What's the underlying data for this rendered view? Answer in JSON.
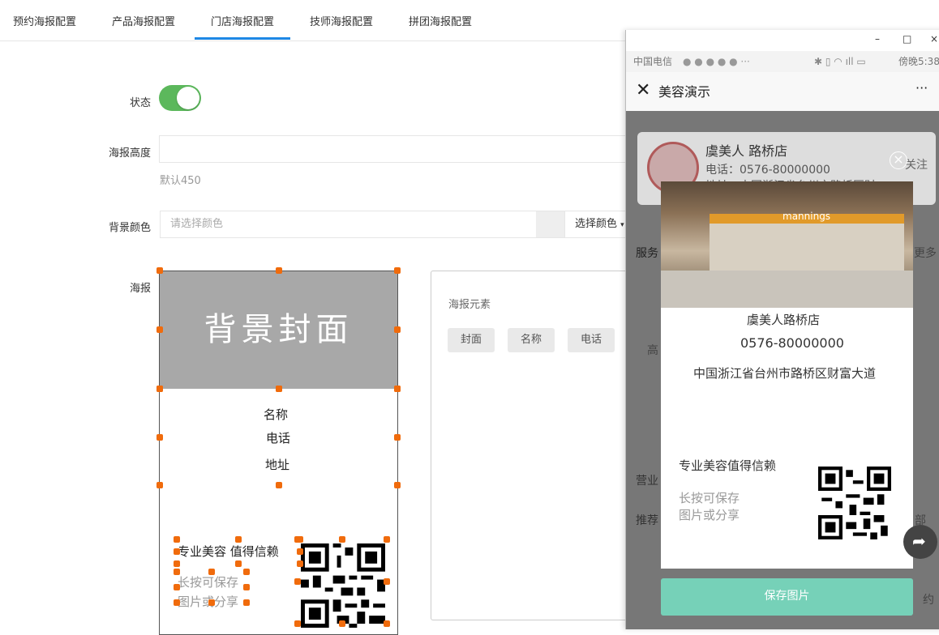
{
  "tabs": [
    {
      "label": "预约海报配置"
    },
    {
      "label": "产品海报配置"
    },
    {
      "label": "门店海报配置"
    },
    {
      "label": "技师海报配置"
    },
    {
      "label": "拼团海报配置"
    }
  ],
  "form": {
    "status_label": "状态",
    "height_label": "海报高度",
    "height_value": "",
    "height_hint": "默认450",
    "bg_color_label": "背景颜色",
    "bg_color_placeholder": "请选择颜色",
    "bg_color_button": "选择颜色",
    "poster_label": "海报"
  },
  "poster": {
    "cover_text": "背景封面",
    "name_text": "名称",
    "phone_text": "电话",
    "address_text": "地址",
    "slogan": "专业美容 值得信赖",
    "hint_line1": "长按可保存",
    "hint_line2": "图片或分享",
    "handle_color": "#f06b0c"
  },
  "elements_panel": {
    "title": "海报元素",
    "chips": [
      {
        "label": "封面"
      },
      {
        "label": "名称"
      },
      {
        "label": "电话"
      }
    ]
  },
  "phone": {
    "window_controls": {
      "minimize": "–",
      "maximize": "□",
      "close": "×"
    },
    "status_left": "中国电信",
    "status_right": "傍晚5:38",
    "title": "美容演示",
    "more": "···",
    "store_name": "虞美人 路桥店",
    "store_phone": "电话：0576-80000000",
    "store_address": "地址：中国浙江省台州市路桥区财",
    "follow": "关注",
    "bg_service": "服务",
    "bg_more": "更多",
    "bg_hours": "营业",
    "bg_recommend": "推荐",
    "bg_high": "高",
    "bg_all": "部",
    "bg_reserve": "约",
    "popup": {
      "photo_sign": "mannings",
      "name": "虞美人路桥店",
      "phone": "0576-80000000",
      "address": "中国浙江省台州市路桥区财富大道",
      "slogan": "专业美容值得信赖",
      "hint_line1": "长按可保存",
      "hint_line2": "图片或分享"
    },
    "save_button": "保存图片"
  }
}
